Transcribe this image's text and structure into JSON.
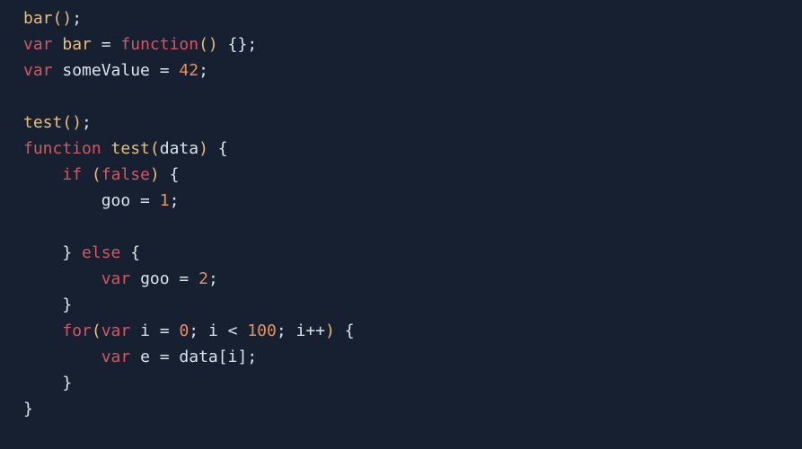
{
  "code": {
    "lines": [
      [
        {
          "cls": "fn",
          "t": "bar"
        },
        {
          "cls": "paren",
          "t": "()"
        },
        {
          "cls": "semi",
          "t": ";"
        }
      ],
      [
        {
          "cls": "kw",
          "t": "var"
        },
        {
          "cls": "op",
          "t": " "
        },
        {
          "cls": "fn",
          "t": "bar"
        },
        {
          "cls": "op",
          "t": " = "
        },
        {
          "cls": "kw",
          "t": "function"
        },
        {
          "cls": "paren",
          "t": "()"
        },
        {
          "cls": "op",
          "t": " "
        },
        {
          "cls": "brace",
          "t": "{}"
        },
        {
          "cls": "semi",
          "t": ";"
        }
      ],
      [
        {
          "cls": "kw",
          "t": "var"
        },
        {
          "cls": "op",
          "t": " "
        },
        {
          "cls": "ident",
          "t": "someValue"
        },
        {
          "cls": "op",
          "t": " = "
        },
        {
          "cls": "num",
          "t": "42"
        },
        {
          "cls": "semi",
          "t": ";"
        }
      ],
      [
        {
          "cls": "op",
          "t": " "
        }
      ],
      [
        {
          "cls": "fn",
          "t": "test"
        },
        {
          "cls": "paren",
          "t": "()"
        },
        {
          "cls": "semi",
          "t": ";"
        }
      ],
      [
        {
          "cls": "kw",
          "t": "function"
        },
        {
          "cls": "op",
          "t": " "
        },
        {
          "cls": "fn",
          "t": "test"
        },
        {
          "cls": "paren",
          "t": "("
        },
        {
          "cls": "ident",
          "t": "data"
        },
        {
          "cls": "paren",
          "t": ")"
        },
        {
          "cls": "op",
          "t": " "
        },
        {
          "cls": "brace",
          "t": "{"
        }
      ],
      [
        {
          "cls": "op",
          "t": "    "
        },
        {
          "cls": "kw",
          "t": "if"
        },
        {
          "cls": "op",
          "t": " "
        },
        {
          "cls": "paren",
          "t": "("
        },
        {
          "cls": "kw",
          "t": "false"
        },
        {
          "cls": "paren",
          "t": ")"
        },
        {
          "cls": "op",
          "t": " "
        },
        {
          "cls": "brace",
          "t": "{"
        }
      ],
      [
        {
          "cls": "op",
          "t": "        "
        },
        {
          "cls": "ident",
          "t": "goo"
        },
        {
          "cls": "op",
          "t": " = "
        },
        {
          "cls": "num",
          "t": "1"
        },
        {
          "cls": "semi",
          "t": ";"
        }
      ],
      [
        {
          "cls": "op",
          "t": " "
        }
      ],
      [
        {
          "cls": "op",
          "t": "    "
        },
        {
          "cls": "brace",
          "t": "}"
        },
        {
          "cls": "op",
          "t": " "
        },
        {
          "cls": "kw",
          "t": "else"
        },
        {
          "cls": "op",
          "t": " "
        },
        {
          "cls": "brace",
          "t": "{"
        }
      ],
      [
        {
          "cls": "op",
          "t": "        "
        },
        {
          "cls": "kw",
          "t": "var"
        },
        {
          "cls": "op",
          "t": " "
        },
        {
          "cls": "ident",
          "t": "goo"
        },
        {
          "cls": "op",
          "t": " = "
        },
        {
          "cls": "num",
          "t": "2"
        },
        {
          "cls": "semi",
          "t": ";"
        }
      ],
      [
        {
          "cls": "op",
          "t": "    "
        },
        {
          "cls": "brace",
          "t": "}"
        }
      ],
      [
        {
          "cls": "op",
          "t": "    "
        },
        {
          "cls": "kw",
          "t": "for"
        },
        {
          "cls": "paren",
          "t": "("
        },
        {
          "cls": "kw",
          "t": "var"
        },
        {
          "cls": "op",
          "t": " "
        },
        {
          "cls": "ident",
          "t": "i"
        },
        {
          "cls": "op",
          "t": " = "
        },
        {
          "cls": "num",
          "t": "0"
        },
        {
          "cls": "semi",
          "t": ";"
        },
        {
          "cls": "op",
          "t": " "
        },
        {
          "cls": "ident",
          "t": "i"
        },
        {
          "cls": "op",
          "t": " < "
        },
        {
          "cls": "num",
          "t": "100"
        },
        {
          "cls": "semi",
          "t": ";"
        },
        {
          "cls": "op",
          "t": " "
        },
        {
          "cls": "ident",
          "t": "i"
        },
        {
          "cls": "op",
          "t": "++"
        },
        {
          "cls": "paren",
          "t": ")"
        },
        {
          "cls": "op",
          "t": " "
        },
        {
          "cls": "brace",
          "t": "{"
        }
      ],
      [
        {
          "cls": "op",
          "t": "        "
        },
        {
          "cls": "kw",
          "t": "var"
        },
        {
          "cls": "op",
          "t": " "
        },
        {
          "cls": "ident",
          "t": "e"
        },
        {
          "cls": "op",
          "t": " = "
        },
        {
          "cls": "ident",
          "t": "data"
        },
        {
          "cls": "brack",
          "t": "["
        },
        {
          "cls": "ident",
          "t": "i"
        },
        {
          "cls": "brack",
          "t": "]"
        },
        {
          "cls": "semi",
          "t": ";"
        }
      ],
      [
        {
          "cls": "op",
          "t": "    "
        },
        {
          "cls": "brace",
          "t": "}"
        }
      ],
      [
        {
          "cls": "brace",
          "t": "}"
        }
      ]
    ]
  },
  "colors": {
    "background": "#172030",
    "keyword": "#d35762",
    "function": "#e8bf7a",
    "identifier": "#dce3ed",
    "number": "#e6915c"
  }
}
